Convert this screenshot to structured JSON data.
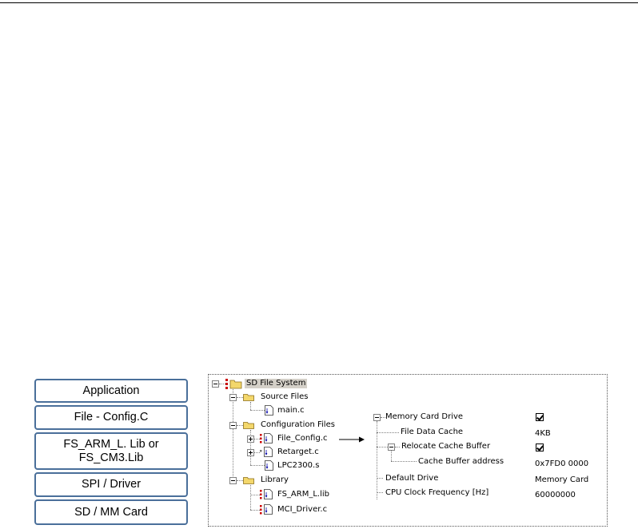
{
  "layers": [
    "Application",
    "File - Config.C",
    "FS_ARM_L. Lib or",
    "FS_CM3.Lib",
    "SPI / Driver",
    "SD / MM Card"
  ],
  "tree": {
    "root": "SD File System",
    "source_files": "Source Files",
    "main_c": "main.c",
    "config_files": "Configuration Files",
    "file_config": "File_Config.c",
    "retarget": "Retarget.c",
    "lpc": "LPC2300.s",
    "library": "Library",
    "fs_arm": "FS_ARM_L.lib",
    "mci_driver": "MCI_Driver.c"
  },
  "config": {
    "memory_card_drive": "Memory Card Drive",
    "file_data_cache": "File Data Cache",
    "file_data_cache_value": "4KB",
    "relocate_cache_buffer": "Relocate Cache Buffer",
    "cache_buffer_address": "Cache Buffer address",
    "cache_buffer_address_value": "0x7FD0 0000",
    "default_drive": "Default Drive",
    "default_drive_value": "Memory Card",
    "cpu_clock": "CPU Clock Frequency [Hz]",
    "cpu_clock_value": "60000000",
    "memory_card_drive_checked": true,
    "relocate_cache_buffer_checked": true
  },
  "icons": [
    "folder-icon",
    "file-icon",
    "project-icon",
    "checkbox-checked-icon",
    "arrow-icon"
  ],
  "colors": {
    "layer_border": "#4a6f9a",
    "folder": "#f3d76b"
  }
}
